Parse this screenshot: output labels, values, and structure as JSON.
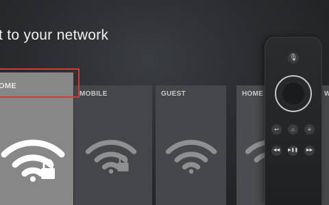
{
  "screen": {
    "title": "t to your network"
  },
  "networks": [
    {
      "label": "OME",
      "secured": true,
      "focused": true
    },
    {
      "label": "MOBILE",
      "secured": true
    },
    {
      "label": "GUEST",
      "secured": false
    },
    {
      "label": "HOME",
      "secured": false
    },
    {
      "label": "W",
      "secured": false
    }
  ],
  "colors": {
    "focus_border": "#d43a3a",
    "tile_focused": "#878787",
    "tile_normal": "#45474a",
    "background": "#2a2c2f"
  },
  "remote": {
    "buttons": [
      {
        "name": "mic-icon",
        "glyph": "🎙"
      },
      {
        "name": "back-icon",
        "glyph": "↩"
      },
      {
        "name": "home-icon",
        "glyph": "⌂"
      },
      {
        "name": "menu-icon",
        "glyph": "≡"
      },
      {
        "name": "rewind-icon",
        "glyph": "◀◀"
      },
      {
        "name": "play-pause-icon",
        "glyph": "▶❚❚"
      },
      {
        "name": "fast-forward-icon",
        "glyph": "▶▶"
      }
    ]
  }
}
